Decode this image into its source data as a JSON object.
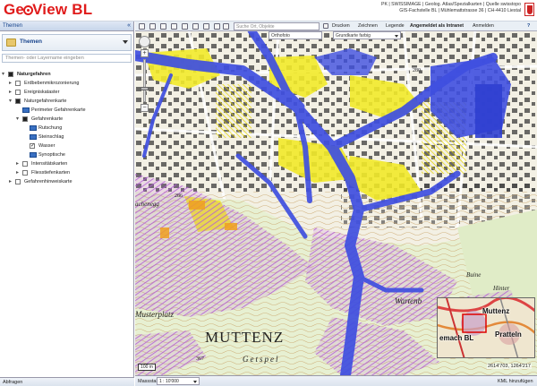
{
  "header": {
    "logo_prefix": "Ge",
    "logo_suffix": "View BL",
    "links_line1": "PK | SWISSIMAGE | Geolog. Atlas/Spezialkarten | Quelle swisstopo",
    "links_line2": "GIS-Fachstelle BL | Mühlemattstrasse 36 | CH-4410 Liestal"
  },
  "left_panel": {
    "title": "Themen",
    "collapse": "«",
    "theme_select": "Themen",
    "search_placeholder": "Themen- oder Layername eingeben",
    "footer": "Abfragen",
    "tree": [
      {
        "label": "Naturgefahren",
        "toggle": "▾",
        "level": 0,
        "bold": true,
        "cb": "on"
      },
      {
        "label": "Erdbebenmikrozonierung",
        "toggle": "▸",
        "level": 1,
        "cb": "off"
      },
      {
        "label": "Ereigniskataster",
        "toggle": "▸",
        "level": 1,
        "cb": "off"
      },
      {
        "label": "Naturgefahrenkarte",
        "toggle": "▾",
        "level": 1,
        "cb": "on"
      },
      {
        "label": "Perimeter Gefahrenkarte",
        "toggle": "",
        "level": 2,
        "cb": "icon"
      },
      {
        "label": "Gefahrenkarte",
        "toggle": "▾",
        "level": 2,
        "cb": "on"
      },
      {
        "label": "Rutschung",
        "toggle": "",
        "level": 3,
        "cb": "icon"
      },
      {
        "label": "Steinschlag",
        "toggle": "",
        "level": 3,
        "cb": "icon"
      },
      {
        "label": "Wasser",
        "toggle": "",
        "level": 3,
        "cb": "chk"
      },
      {
        "label": "Synoptische",
        "toggle": "",
        "level": 3,
        "cb": "icon"
      },
      {
        "label": "Intensitätskarten",
        "toggle": "▸",
        "level": 2,
        "cb": "off"
      },
      {
        "label": "Fliesstiefenkarten",
        "toggle": "▸",
        "level": 2,
        "cb": "off"
      },
      {
        "label": "Gefahrenhinweiskarte",
        "toggle": "▸",
        "level": 1,
        "cb": "off"
      }
    ]
  },
  "toolbar": {
    "search_placeholder": "Suche Ort, Objekte",
    "drucken": "Drucken",
    "zeichnen": "Zeichnen",
    "legende": "Legende",
    "angemeldet": "Angemeldet als Intranet",
    "anmelden": "Anmelden",
    "help": "?"
  },
  "layerbar": {
    "orthofoto": "Orthofoto",
    "grundkarte": "Grundkarte farbig"
  },
  "map": {
    "scale_label": "100 m",
    "coordinates": "2614'703, 1264'217",
    "labels": {
      "muttenz": "MUTTENZ",
      "musterplatz": "Musterplatz",
      "getspel": "Getspel",
      "wartenb": "Wartenb",
      "elev_280": "280",
      "elev_286": "286",
      "elev_367": "367",
      "buine": "Buine",
      "hinter": "Hinter",
      "lachenegg": "achenegg"
    },
    "overview": {
      "town1": "Muttenz",
      "town2": "Pratteln",
      "town3": "emach BL"
    }
  },
  "footer": {
    "massstab_label": "Massstab",
    "massstab_value": "1 : 10'000",
    "kml": "KML hinzufügen"
  },
  "colors": {
    "hazard_blue": "#3f4fe0",
    "hazard_yellow": "#f2ea2a",
    "hazard_violet": "#b25ad8",
    "logo_red": "#e01b1b"
  }
}
